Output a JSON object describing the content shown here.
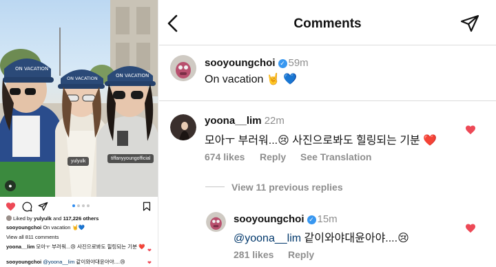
{
  "left": {
    "tags": [
      "yulyulk",
      "tiffanyyoungofficial"
    ],
    "liked_by": {
      "prefix": "Liked by ",
      "user": "yulyulk",
      "middle": " and ",
      "count": "117,226 others"
    },
    "caption": {
      "user": "sooyoungchoi",
      "text": "On vacation 🤘💙"
    },
    "view_all": "View all 811 comments",
    "comments": [
      {
        "user": "yoona__lim",
        "text": "모아ㅜ 부러워...😢 사진으로봐도 힐링되는 기분 ❤️"
      },
      {
        "user": "sooyoungchoi",
        "mention": "@yoona__lim",
        "text": "같이와야대윤아야....😢"
      }
    ],
    "carousel": {
      "total": 4,
      "active": 1
    }
  },
  "header": {
    "title": "Comments"
  },
  "post": {
    "user": "sooyoungchoi",
    "time": "59m",
    "text": "On vacation 🤘 💙"
  },
  "comment1": {
    "user": "yoona__lim",
    "time": "22m",
    "text": "모아ㅜ 부러워...😢  사진으로봐도 힐링되는 기분 ❤️",
    "likes": "674 likes",
    "reply": "Reply",
    "translate": "See Translation"
  },
  "view_replies": "View 11 previous replies",
  "reply1": {
    "user": "sooyoungchoi",
    "time": "15m",
    "mention": "@yoona__lim",
    "text": " 같이와야대윤아야....😢",
    "likes": "281 likes",
    "reply": "Reply"
  },
  "colors": {
    "like_red": "#ed4956",
    "verified_blue": "#3897f0",
    "mention_blue": "#00376b",
    "muted": "#8e8e8e"
  }
}
